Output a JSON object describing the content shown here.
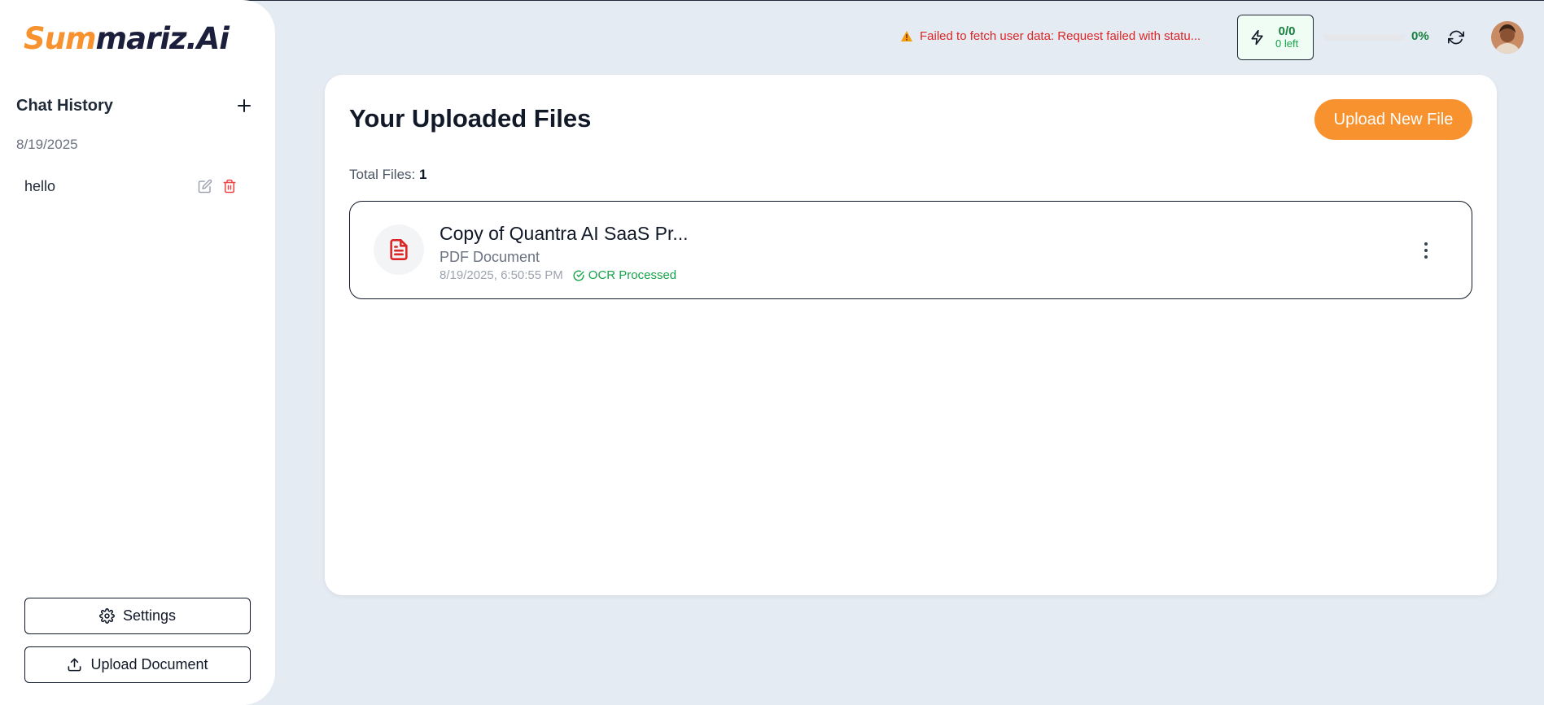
{
  "logo": {
    "part1": "Sum",
    "part2": "mariz.Ai"
  },
  "sidebar": {
    "chat_history_title": "Chat History",
    "date_group": "8/19/2025",
    "chats": [
      {
        "label": "hello"
      }
    ],
    "settings_label": "Settings",
    "upload_label": "Upload Document"
  },
  "topbar": {
    "warning_text": "Failed to fetch user data: Request failed with statu...",
    "credits_main": "0/0",
    "credits_sub": "0 left",
    "progress_label": "0%",
    "progress_value": 0
  },
  "main": {
    "title": "Your Uploaded Files",
    "upload_button": "Upload New File",
    "total_label": "Total Files:",
    "total_count": "1",
    "files": [
      {
        "name": "Copy of Quantra AI SaaS Pr...",
        "type": "PDF Document",
        "date": "8/19/2025, 6:50:55 PM",
        "status": "OCR Processed"
      }
    ]
  },
  "colors": {
    "accent": "#f7922e",
    "brand_dark": "#1b1f3b",
    "success": "#16a34a",
    "danger": "#dc2626",
    "background": "#e5ebf3"
  },
  "icons": [
    "plus-icon",
    "edit-icon",
    "trash-icon",
    "gear-icon",
    "upload-icon",
    "warning-icon",
    "bolt-icon",
    "refresh-icon",
    "file-text-icon",
    "check-circle-icon",
    "more-vertical-icon"
  ]
}
